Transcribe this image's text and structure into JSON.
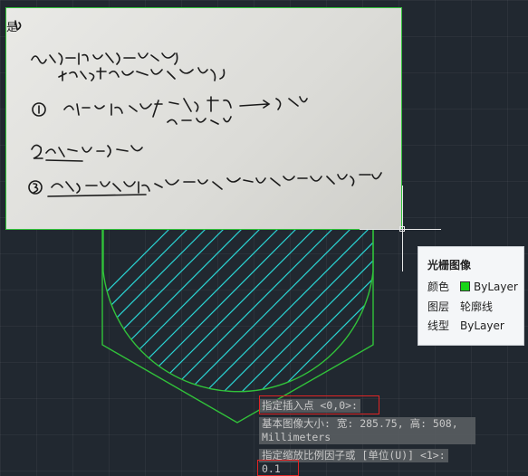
{
  "tooltip": {
    "title": "光栅图像",
    "rows": [
      {
        "key": "颜色",
        "value": "ByLayer",
        "swatch": "#18d418"
      },
      {
        "key": "图层",
        "value": "轮廓线"
      },
      {
        "key": "线型",
        "value": "ByLayer"
      }
    ]
  },
  "command": {
    "prompt1": "指定插入点 <0,0>:",
    "info_line1": "基本图像大小: 宽: 285.75, 高: 508,",
    "info_line2": "Millimeters",
    "prompt2": "指定缩放比例因子或 [单位(U)] <1>:",
    "input_value": "0.1"
  },
  "image_side_text": "是",
  "colors": {
    "background": "#212830",
    "geometry": "#31c23a",
    "hatch": "#2bd4d4",
    "highlight": "#e02424"
  }
}
